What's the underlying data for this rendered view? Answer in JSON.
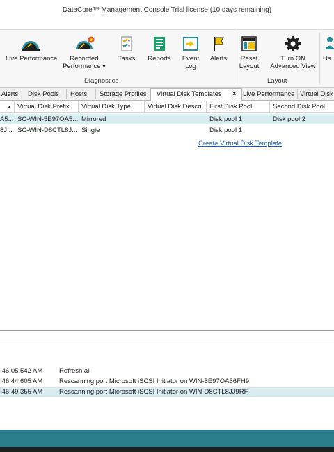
{
  "window": {
    "title": "DataCore™ Management Console   Trial license (10 days remaining)"
  },
  "ribbon": {
    "buttons": [
      {
        "id": "live-performance",
        "label": "Live Performance",
        "icon": "gauge-icon"
      },
      {
        "id": "recorded-performance",
        "label": "Recorded Performance ▾",
        "icon": "gauge-record-icon"
      },
      {
        "id": "tasks",
        "label": "Tasks",
        "icon": "tasks-checklist-icon"
      },
      {
        "id": "reports",
        "label": "Reports",
        "icon": "report-icon"
      },
      {
        "id": "event-log",
        "label": "Event Log",
        "icon": "event-log-icon"
      },
      {
        "id": "alerts",
        "label": "Alerts",
        "icon": "flag-icon"
      },
      {
        "id": "reset-layout",
        "label": "Reset Layout",
        "icon": "layout-icon"
      },
      {
        "id": "advanced-view",
        "label": "Turn ON Advanced View",
        "icon": "gear-icon"
      },
      {
        "id": "users",
        "label": "Us",
        "icon": "users-icon"
      }
    ],
    "groups": {
      "diagnostics": "Diagnostics",
      "layout": "Layout"
    }
  },
  "tabs": [
    {
      "label": "Alerts",
      "active": false
    },
    {
      "label": "Disk Pools",
      "active": false
    },
    {
      "label": "Hosts",
      "active": false
    },
    {
      "label": "Storage Profiles",
      "active": false
    },
    {
      "label": "Virtual Disk Templates",
      "active": true
    },
    {
      "label": "Live Performance",
      "active": false
    },
    {
      "label": "Virtual Disk",
      "active": false
    }
  ],
  "tab_close_glyph": "✕",
  "grid": {
    "columns": [
      "",
      "Virtual Disk Prefix",
      "Virtual Disk Type",
      "Virtual Disk Descri...",
      "First Disk Pool",
      "Second Disk Pool"
    ],
    "sort_glyph": "▲",
    "rows": [
      {
        "name": "A5...",
        "prefix": "SC-WIN-5E97OA5...",
        "type": "Mirrored",
        "description": "",
        "first_pool": "Disk pool 1",
        "second_pool": "Disk pool 2",
        "selected": true
      },
      {
        "name": "8J...",
        "prefix": "SC-WIN-D8CTL8J...",
        "type": "Single",
        "description": "",
        "first_pool": "Disk pool 1",
        "second_pool": "",
        "selected": false
      }
    ],
    "create_link": "Create Virtual Disk Template"
  },
  "log": {
    "entries": [
      {
        "time": ":46:05.542 AM",
        "message": "Refresh all",
        "highlight": false
      },
      {
        "time": ":46:44.605 AM",
        "message": "Rescanning port Microsoft iSCSI Initiator on WIN-5E97OA56FH9.",
        "highlight": false
      },
      {
        "time": ":46:49.355 AM",
        "message": "Rescanning port Microsoft iSCSI Initiator on WIN-D8CTL8JJ9RF.",
        "highlight": true
      }
    ]
  },
  "colors": {
    "accent_teal": "#2d7e8c",
    "selected_row": "#d9ecf0",
    "link": "#1a5fb4"
  }
}
